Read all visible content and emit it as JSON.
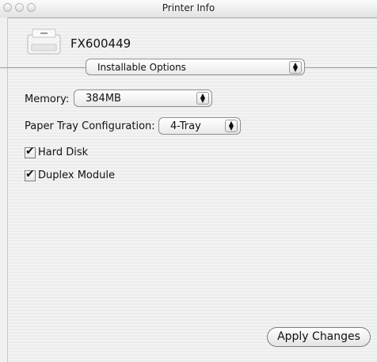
{
  "window": {
    "title": "Printer Info"
  },
  "printer": {
    "name": "FX600449"
  },
  "pane_selector": {
    "value": "Installable Options"
  },
  "memory": {
    "label": "Memory:",
    "value": "384MB"
  },
  "paper_tray": {
    "label": "Paper Tray Configuration:",
    "value": "4-Tray"
  },
  "options": [
    {
      "label": "Hard Disk",
      "checked": true
    },
    {
      "label": "Duplex Module",
      "checked": true
    }
  ],
  "apply_button": {
    "label": "Apply Changes"
  }
}
